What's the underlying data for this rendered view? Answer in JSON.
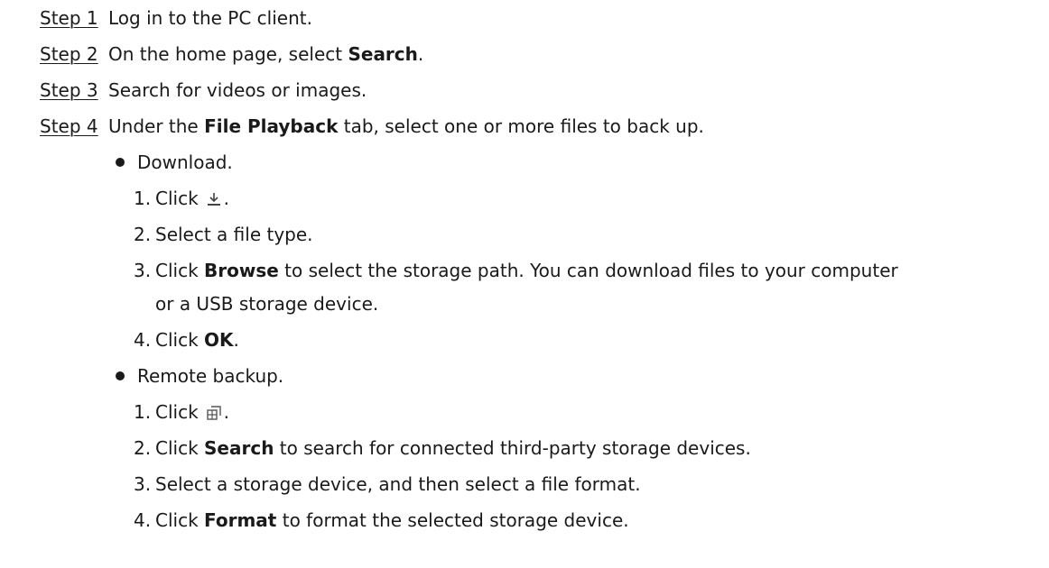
{
  "steps": [
    {
      "label": "Step 1",
      "text": "Log in to the PC client."
    },
    {
      "label": "Step 2",
      "pre": "On the home page, select ",
      "bold": "Search",
      "post": "."
    },
    {
      "label": "Step 3",
      "text": "Search for videos or images."
    },
    {
      "label": "Step 4",
      "pre": "Under the ",
      "bold": "File Playback",
      "post": " tab, select one or more files to back up."
    }
  ],
  "download": {
    "title": "Download.",
    "items": [
      {
        "num": "1.",
        "pre": "Click",
        "icon": "download-icon",
        "post": "."
      },
      {
        "num": "2.",
        "text": "Select a file type."
      },
      {
        "num": "3.",
        "pre": "Click ",
        "bold": "Browse",
        "post": " to select the storage path. You can download files to your computer",
        "cont": "or a USB storage device."
      },
      {
        "num": "4.",
        "pre": "Click ",
        "bold": "OK",
        "post": "."
      }
    ]
  },
  "remote": {
    "title": "Remote backup.",
    "items": [
      {
        "num": "1.",
        "pre": "Click",
        "icon": "remote-backup-icon",
        "post": "."
      },
      {
        "num": "2.",
        "pre": "Click ",
        "bold": "Search",
        "post": " to search for connected third-party storage devices."
      },
      {
        "num": "3.",
        "text": "Select a storage device, and then select a file format."
      },
      {
        "num": "4.",
        "pre": "Click ",
        "bold": "Format",
        "post": " to format the selected storage device."
      }
    ]
  }
}
